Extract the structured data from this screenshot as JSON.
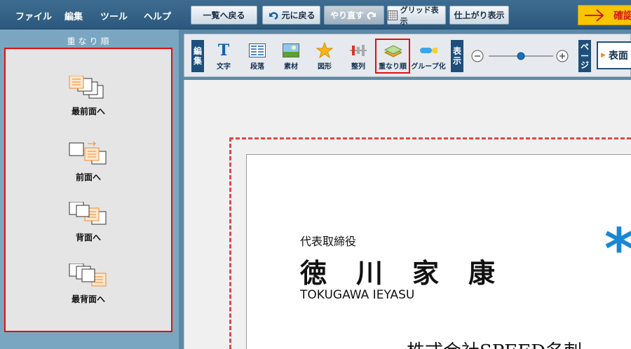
{
  "menu": [
    "ファイル",
    "編集",
    "ツール",
    "ヘルプ"
  ],
  "topbar": {
    "list_button": "一覧へ戻る",
    "undo_button": "元に戻る",
    "redo_button": "やり直す",
    "grid_button": "グリッド表示",
    "finish_button": "仕上がり表示",
    "confirm_button": "確認"
  },
  "left_panel": {
    "title": "重なり順",
    "items": [
      "最前面へ",
      "前面へ",
      "背面へ",
      "最背面へ"
    ]
  },
  "toolbar": {
    "edit_label": [
      "編",
      "集"
    ],
    "tools": [
      "文字",
      "段落",
      "素材",
      "図形",
      "整列",
      "重なり順",
      "グループ化"
    ],
    "view_label": [
      "表",
      "示"
    ],
    "page_label": [
      "ペ",
      "ー",
      "ジ"
    ],
    "side_label": "表面",
    "zoom_level": 0.5
  },
  "card": {
    "title": "代表取締役",
    "name": "徳　川　家　康",
    "romaji": "TOKUGAWA IEYASU",
    "company": "株式会社SPEED名刺",
    "logo_mark": "*"
  },
  "colors": {
    "highlight": "#e40d0d",
    "nav_blue": "#1e4f7c",
    "guide": "#e04848"
  }
}
